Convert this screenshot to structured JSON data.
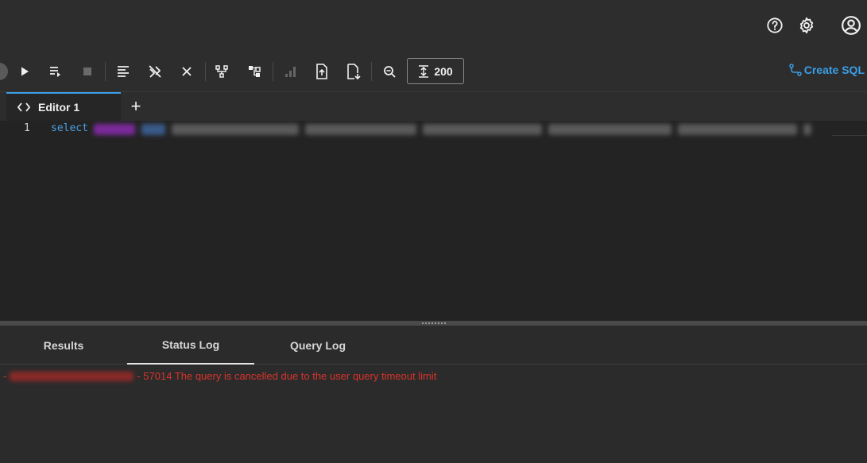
{
  "header": {
    "icons": [
      "help-circle-icon",
      "gear-icon",
      "account-circle-icon"
    ]
  },
  "toolbar": {
    "limit_value": "200",
    "create_sql_label": "Create SQL"
  },
  "editor_tabs": [
    {
      "label": "Editor 1",
      "active": true
    }
  ],
  "editor": {
    "line_number": "1",
    "keyword": "select"
  },
  "results_tabs": [
    {
      "label": "Results",
      "active": false
    },
    {
      "label": "Status Log",
      "active": true
    },
    {
      "label": "Query Log",
      "active": false
    }
  ],
  "status_log": {
    "prefix": "-",
    "message": "- 57014 The query is cancelled due to the user query timeout limit"
  },
  "colors": {
    "accent": "#3b9fe8",
    "error": "#d9332b",
    "background": "#2b2b2b",
    "editor_background": "#232323"
  }
}
